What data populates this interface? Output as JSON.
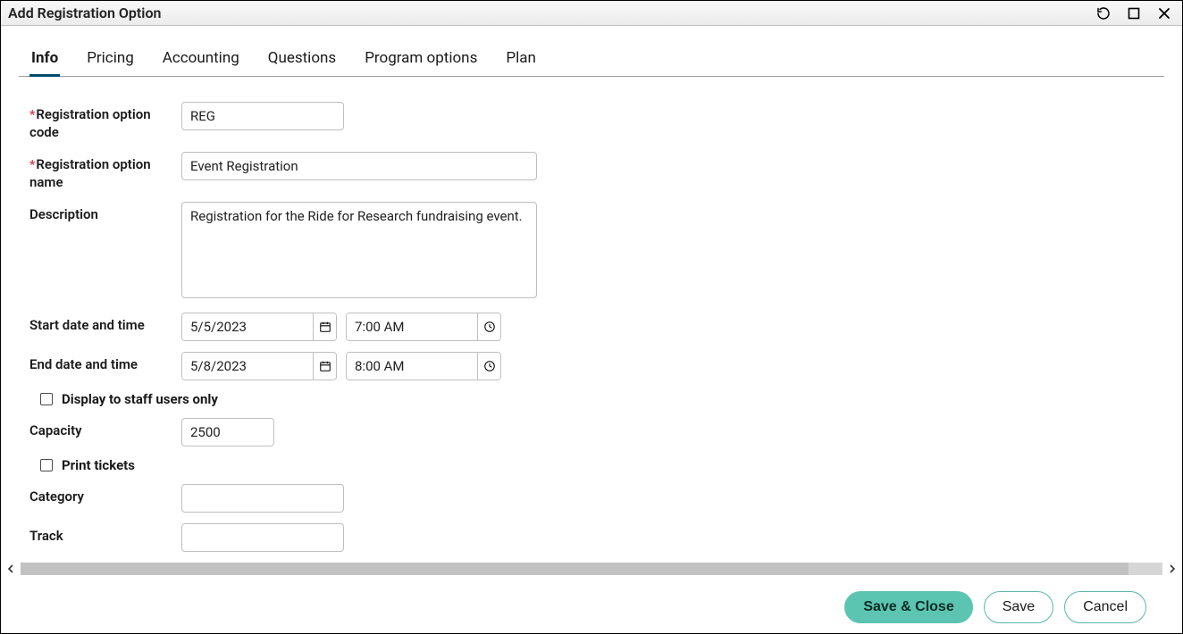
{
  "titlebar": {
    "title": "Add Registration Option"
  },
  "tabs": {
    "items": [
      {
        "label": "Info",
        "active": true
      },
      {
        "label": "Pricing"
      },
      {
        "label": "Accounting"
      },
      {
        "label": "Questions"
      },
      {
        "label": "Program options"
      },
      {
        "label": "Plan"
      }
    ]
  },
  "form": {
    "code_label": "Registration option code",
    "code_value": "REG",
    "name_label": "Registration option name",
    "name_value": "Event Registration",
    "desc_label": "Description",
    "desc_value": "Registration for the Ride for Research fundraising event.",
    "start_label": "Start date and time",
    "start_date": "5/5/2023",
    "start_time": "7:00 AM",
    "end_label": "End date and time",
    "end_date": "5/8/2023",
    "end_time": "8:00 AM",
    "staff_only_label": "Display to staff users only",
    "staff_only_checked": false,
    "capacity_label": "Capacity",
    "capacity_value": "2500",
    "print_tickets_label": "Print tickets",
    "print_tickets_checked": false,
    "category_label": "Category",
    "category_value": "",
    "track_label": "Track",
    "track_value": ""
  },
  "footer": {
    "save_close_label": "Save & Close",
    "save_label": "Save",
    "cancel_label": "Cancel"
  }
}
